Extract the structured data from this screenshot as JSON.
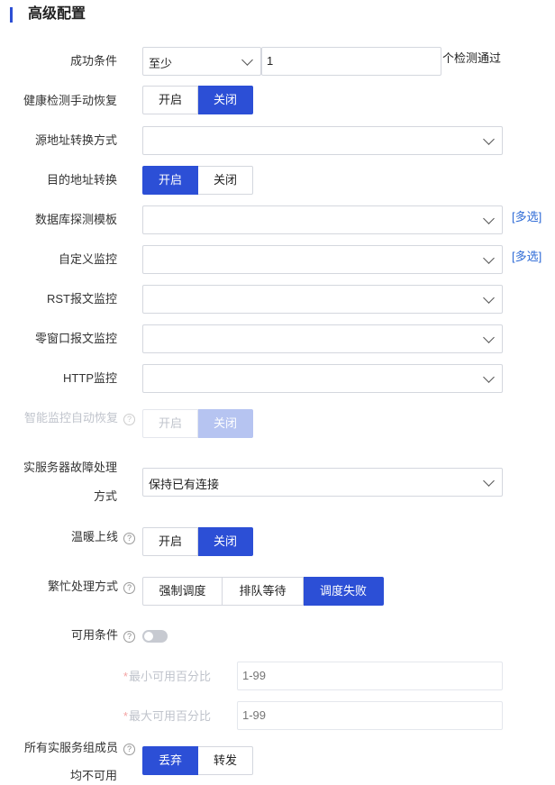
{
  "section": {
    "title": "高级配置"
  },
  "success_condition": {
    "label": "成功条件",
    "select_value": "至少",
    "count_value": "1",
    "suffix": "个检测通过"
  },
  "health_manual_recover": {
    "label": "健康检测手动恢复",
    "options": [
      "开启",
      "关闭"
    ],
    "selected": "关闭"
  },
  "src_addr_translate": {
    "label": "源地址转换方式",
    "value": ""
  },
  "dst_addr_translate": {
    "label": "目的地址转换",
    "options": [
      "开启",
      "关闭"
    ],
    "selected": "开启"
  },
  "db_probe_template": {
    "label": "数据库探测模板",
    "value": "",
    "multi_link": "[多选]"
  },
  "custom_monitor": {
    "label": "自定义监控",
    "value": "",
    "multi_link": "[多选]"
  },
  "rst_monitor": {
    "label": "RST报文监控",
    "value": ""
  },
  "zero_window_monitor": {
    "label": "零窗口报文监控",
    "value": ""
  },
  "http_monitor": {
    "label": "HTTP监控",
    "value": ""
  },
  "smart_monitor_recover": {
    "label": "智能监控自动恢复",
    "options": [
      "开启",
      "关闭"
    ],
    "selected": "关闭",
    "disabled": true
  },
  "real_server_fault": {
    "label_line1": "实服务器故障处理",
    "label_line2": "方式",
    "value": "保持已有连接"
  },
  "warm_up": {
    "label": "温暖上线",
    "options": [
      "开启",
      "关闭"
    ],
    "selected": "关闭"
  },
  "busy_handling": {
    "label": "繁忙处理方式",
    "options": [
      "强制调度",
      "排队等待",
      "调度失败"
    ],
    "selected": "调度失败"
  },
  "availability": {
    "label": "可用条件",
    "enabled": false
  },
  "min_available_pct": {
    "label": "最小可用百分比",
    "placeholder": "1-99"
  },
  "max_available_pct": {
    "label": "最大可用百分比",
    "placeholder": "1-99"
  },
  "all_members_unavailable": {
    "label_line1": "所有实服务组成员",
    "label_line2": "均不可用",
    "options": [
      "丢弃",
      "转发"
    ],
    "selected": "丢弃"
  },
  "icons": {
    "help": "question-circle-icon",
    "dropdown": "chevron-down-icon"
  },
  "colors": {
    "primary": "#2c4fd6",
    "primary_disabled": "#b6c4f1",
    "link": "#2d6ad6"
  }
}
